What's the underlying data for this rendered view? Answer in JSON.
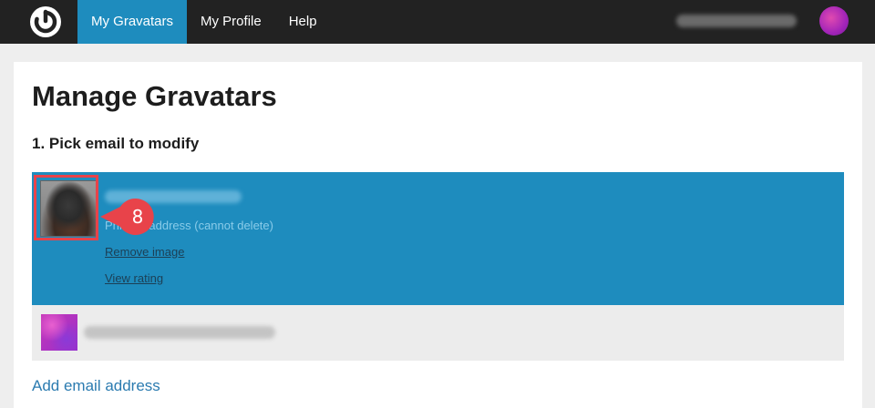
{
  "topbar": {
    "nav": [
      {
        "label": "My Gravatars",
        "active": true
      },
      {
        "label": "My Profile",
        "active": false
      },
      {
        "label": "Help",
        "active": false
      }
    ],
    "accent_color": "#1e8cbe"
  },
  "main": {
    "title": "Manage Gravatars",
    "step_title": "1. Pick email to modify",
    "selected_email": {
      "primary_text": "Primary address (cannot delete)",
      "remove_label": "Remove image",
      "rating_label": "View rating"
    },
    "add_email_label": "Add email address"
  },
  "annotation": {
    "step_number": "8",
    "color": "#e8434a"
  }
}
